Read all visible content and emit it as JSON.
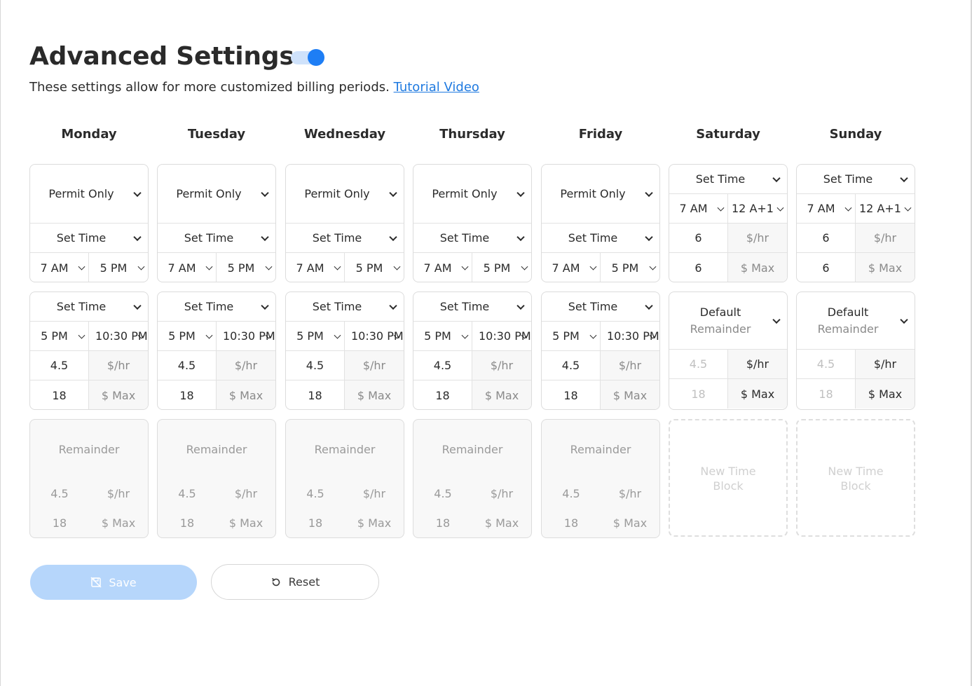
{
  "header": {
    "title": "Advanced Settings",
    "toggle_on": true,
    "subtitle": "These settings allow for more customized billing periods.",
    "tutorial_link": "Tutorial Video"
  },
  "days": [
    {
      "name": "Monday"
    },
    {
      "name": "Tuesday"
    },
    {
      "name": "Wednesday"
    },
    {
      "name": "Thursday"
    },
    {
      "name": "Friday"
    },
    {
      "name": "Saturday"
    },
    {
      "name": "Sunday"
    }
  ],
  "weekday_block1": {
    "mode": "Permit Only",
    "set_time": "Set Time",
    "start": "7 AM",
    "end": "5 PM"
  },
  "weekday_block2": {
    "set_time": "Set Time",
    "start": "5 PM",
    "end": "10:30 PM",
    "rate": "4.5",
    "rate_unit": "$/hr",
    "max": "18",
    "max_unit": "$ Max"
  },
  "weekday_remainder": {
    "label": "Remainder",
    "rate": "4.5",
    "rate_unit": "$/hr",
    "max": "18",
    "max_unit": "$ Max"
  },
  "weekend_block1": {
    "set_time": "Set Time",
    "start": "7 AM",
    "end": "12 A+1",
    "rate": "6",
    "rate_unit": "$/hr",
    "max": "6",
    "max_unit": "$ Max"
  },
  "weekend_block2": {
    "mode_line1": "Default",
    "mode_line2": "Remainder",
    "rate": "4.5",
    "rate_unit": "$/hr",
    "max": "18",
    "max_unit": "$ Max"
  },
  "new_block": {
    "line1": "New Time",
    "line2": "Block"
  },
  "actions": {
    "save": "Save",
    "reset": "Reset"
  },
  "colors": {
    "accent": "#1e7ef5",
    "save_bg": "#b6d6fb",
    "link": "#1f7ae0"
  }
}
